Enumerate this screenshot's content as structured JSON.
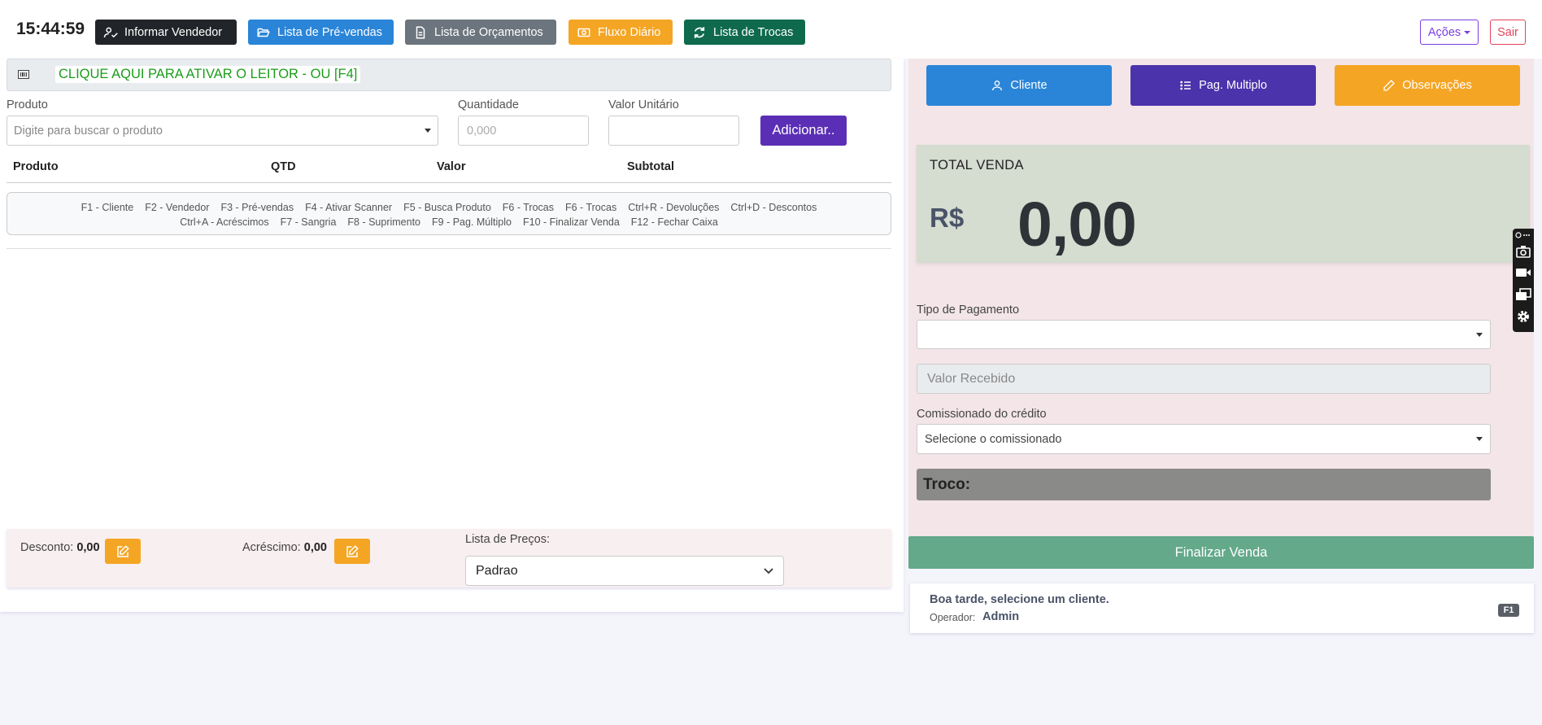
{
  "header": {
    "clock": "15:44:59",
    "buttons": {
      "vendedor": "Informar Vendedor",
      "prevendas": "Lista de Pré-vendas",
      "orcamentos": "Lista de Orçamentos",
      "fluxo": "Fluxo Diário",
      "trocas": "Lista de Trocas"
    },
    "acoes": "Ações",
    "sair": "Sair"
  },
  "scanner": {
    "text": "CLIQUE AQUI PARA ATIVAR O LEITOR - OU [F4]"
  },
  "form": {
    "produto_label": "Produto",
    "produto_placeholder": "Digite para buscar o produto",
    "quantidade_label": "Quantidade",
    "quantidade_placeholder": "0,000",
    "valor_label": "Valor Unitário",
    "valor_value": "",
    "adicionar": "Adicionar.."
  },
  "table": {
    "columns": [
      "Produto",
      "QTD",
      "Valor",
      "Subtotal"
    ],
    "rows": []
  },
  "shortcuts": {
    "line1": [
      "F1 - Cliente",
      "F2 - Vendedor",
      "F3 - Pré-vendas",
      "F4 - Ativar Scanner",
      "F5 - Busca Produto",
      "F6 - Trocas",
      "F6 - Trocas",
      "Ctrl+R - Devoluções",
      "Ctrl+D - Descontos"
    ],
    "line2": [
      "Ctrl+A - Acréscimos",
      "F7 - Sangria",
      "F8 - Suprimento",
      "F9 - Pag. Múltiplo",
      "F10 - Finalizar Venda",
      "F12 - Fechar Caixa"
    ]
  },
  "bottom": {
    "desconto_label": "Desconto:",
    "desconto_value": "0,00",
    "acrescimo_label": "Acréscimo:",
    "acrescimo_value": "0,00",
    "lista_label": "Lista de Preços:",
    "lista_value": "Padrao"
  },
  "right": {
    "buttons": {
      "cliente": "Cliente",
      "pag": "Pag. Multiplo",
      "obs": "Observações"
    },
    "total_label": "TOTAL VENDA",
    "currency": "R$",
    "total_value": "0,00",
    "tipo_label": "Tipo de Pagamento",
    "tipo_value": "",
    "recebido_placeholder": "Valor Recebido",
    "comiss_label": "Comissionado do crédito",
    "comiss_value": "Selecione o comissionado",
    "troco_label": "Troco:",
    "finalizar": "Finalizar Venda",
    "status_msg": "Boa tarde, selecione um cliente.",
    "operador_label": "Operador:",
    "operador_name": "Admin",
    "shortcut_key": "F1"
  },
  "colors": {
    "primary_blue": "#2a85d8",
    "purple": "#4b33ac",
    "orange": "#f5a524",
    "green_dark": "#0f6a4d",
    "finalizar_green": "#63a98a",
    "danger": "#e2445c"
  },
  "icons": [
    "user-check-icon",
    "folder-open-icon",
    "document-icon",
    "money-icon",
    "refresh-icon",
    "barcode-icon",
    "edit-icon",
    "user-icon",
    "list-icon",
    "pencil-icon",
    "camera-icon",
    "video-icon",
    "windows-icon",
    "gear-icon"
  ]
}
